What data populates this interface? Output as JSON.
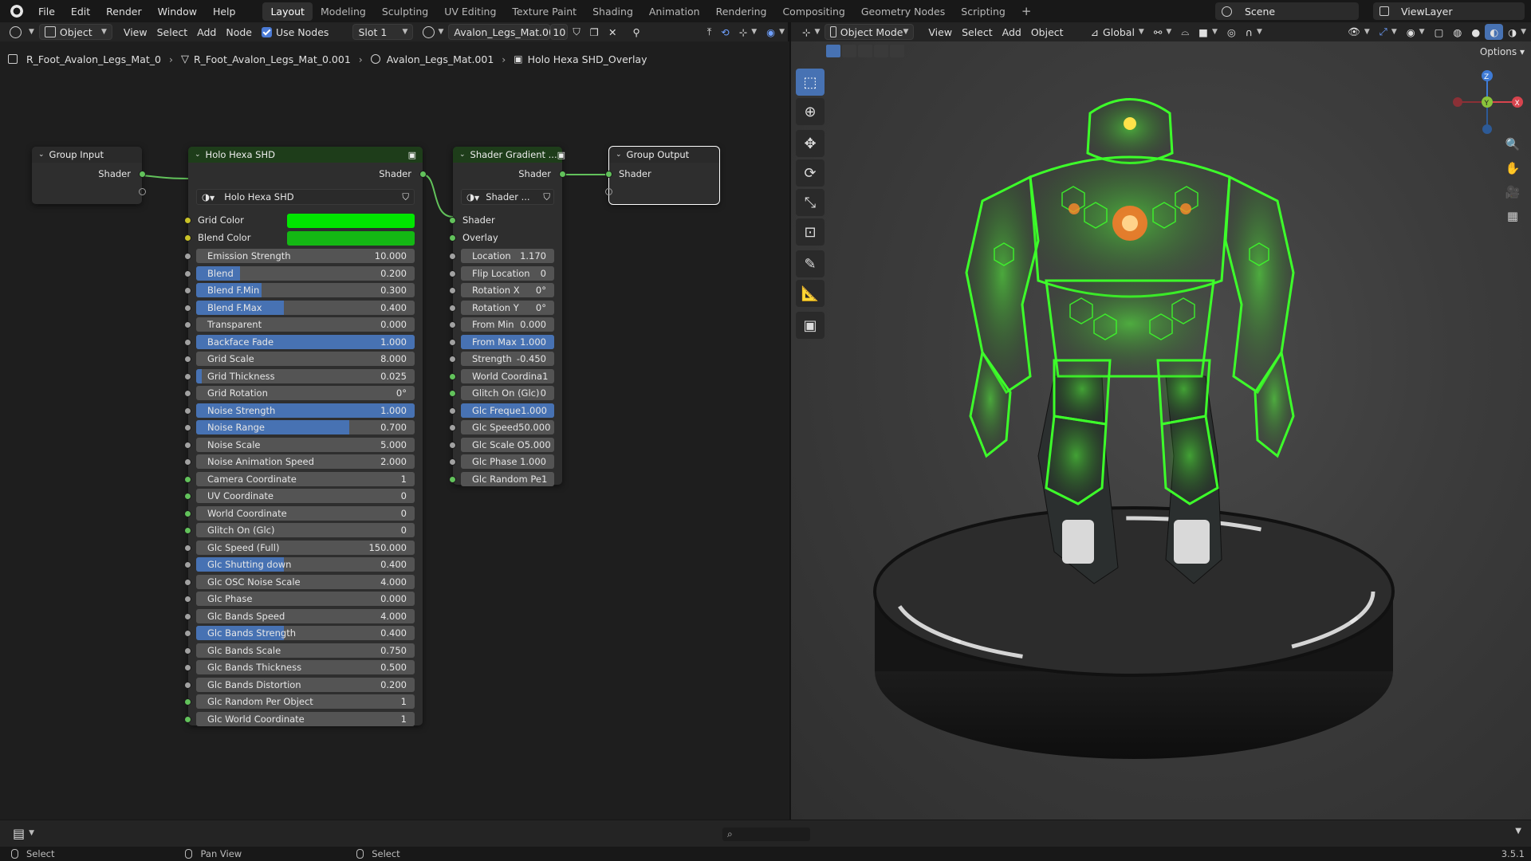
{
  "topbar": {
    "menus": [
      "File",
      "Edit",
      "Render",
      "Window",
      "Help"
    ],
    "workspaces": [
      "Layout",
      "Modeling",
      "Sculpting",
      "UV Editing",
      "Texture Paint",
      "Shading",
      "Animation",
      "Rendering",
      "Compositing",
      "Geometry Nodes",
      "Scripting"
    ],
    "active_workspace": "Layout",
    "add_tab": "+",
    "scene": "Scene",
    "view_layer": "ViewLayer"
  },
  "node_header": {
    "object_mode": "Object",
    "menus": [
      "View",
      "Select",
      "Add",
      "Node"
    ],
    "use_nodes": "Use Nodes",
    "slot": "Slot 1",
    "material": "Avalon_Legs_Mat.001",
    "users": "10"
  },
  "breadcrumb": [
    "R_Foot_Avalon_Legs_Mat_0",
    "R_Foot_Avalon_Legs_Mat_0.001",
    "Avalon_Legs_Mat.001",
    "Holo Hexa SHD_Overlay"
  ],
  "group_input": {
    "title": "Group Input",
    "output": "Shader"
  },
  "holo_node": {
    "title": "Holo Hexa SHD",
    "output": "Shader",
    "tree": "Holo Hexa SHD",
    "grid_color_label": "Grid Color",
    "blend_color_label": "Blend Color",
    "grid_color": "#00e600",
    "blend_color": "#14b814",
    "fields": [
      {
        "label": "Emission Strength",
        "value": "10.000",
        "fill": 0
      },
      {
        "label": "Blend",
        "value": "0.200",
        "fill": 0.2
      },
      {
        "label": "Blend F.Min",
        "value": "0.300",
        "fill": 0.3
      },
      {
        "label": "Blend F.Max",
        "value": "0.400",
        "fill": 0.4
      },
      {
        "label": "Transparent",
        "value": "0.000",
        "fill": 0
      },
      {
        "label": "Backface Fade",
        "value": "1.000",
        "fill": 1
      },
      {
        "label": "Grid Scale",
        "value": "8.000",
        "fill": 0
      },
      {
        "label": "Grid Thickness",
        "value": "0.025",
        "fill": 0.025
      },
      {
        "label": "Grid Rotation",
        "value": "0°",
        "fill": 0
      },
      {
        "label": "Noise Strength",
        "value": "1.000",
        "fill": 1
      },
      {
        "label": "Noise Range",
        "value": "0.700",
        "fill": 0.7
      },
      {
        "label": "Noise Scale",
        "value": "5.000",
        "fill": 0
      },
      {
        "label": "Noise Animation Speed",
        "value": "2.000",
        "fill": 0
      },
      {
        "label": "Camera Coordinate",
        "value": "1",
        "fill": 0
      },
      {
        "label": "UV Coordinate",
        "value": "0",
        "fill": 0
      },
      {
        "label": "World Coordinate",
        "value": "0",
        "fill": 0
      },
      {
        "label": "Glitch On (Glc)",
        "value": "0",
        "fill": 0
      },
      {
        "label": "Glc Speed (Full)",
        "value": "150.000",
        "fill": 0
      },
      {
        "label": "Glc Shutting down",
        "value": "0.400",
        "fill": 0.4
      },
      {
        "label": "Glc OSC Noise Scale",
        "value": "4.000",
        "fill": 0
      },
      {
        "label": "Glc Phase",
        "value": "0.000",
        "fill": 0
      },
      {
        "label": "Glc Bands Speed",
        "value": "4.000",
        "fill": 0
      },
      {
        "label": "Glc Bands Strength",
        "value": "0.400",
        "fill": 0.4
      },
      {
        "label": "Glc Bands Scale",
        "value": "0.750",
        "fill": 0
      },
      {
        "label": "Glc Bands Thickness",
        "value": "0.500",
        "fill": 0
      },
      {
        "label": "Glc Bands Distortion",
        "value": "0.200",
        "fill": 0
      },
      {
        "label": "Glc Random Per Object",
        "value": "1",
        "fill": 0
      },
      {
        "label": "Glc World Coordinate",
        "value": "1",
        "fill": 0
      }
    ]
  },
  "gradient_node": {
    "title": "Shader Gradient ...",
    "output": "Shader",
    "tree": "Shader ...",
    "inputs": [
      "Shader",
      "Overlay"
    ],
    "fields": [
      {
        "label": "Location",
        "value": "1.170",
        "fill": 0
      },
      {
        "label": "Flip Location",
        "value": "0",
        "fill": 0
      },
      {
        "label": "Rotation X",
        "value": "0°",
        "fill": 0
      },
      {
        "label": "Rotation Y",
        "value": "0°",
        "fill": 0
      },
      {
        "label": "From Min",
        "value": "0.000",
        "fill": 0
      },
      {
        "label": "From Max",
        "value": "1.000",
        "fill": 1
      },
      {
        "label": "Strength",
        "value": "-0.450",
        "fill": 0
      },
      {
        "label": "World Coordina",
        "value": "1",
        "fill": 0
      },
      {
        "label": "Glitch On (Glc)",
        "value": "0",
        "fill": 0
      },
      {
        "label": "Glc Freque",
        "value": "1.000",
        "fill": 1
      },
      {
        "label": "Glc Speed",
        "value": "50.000",
        "fill": 0
      },
      {
        "label": "Glc Scale O",
        "value": "5.000",
        "fill": 0
      },
      {
        "label": "Glc Phase",
        "value": "1.000",
        "fill": 0
      },
      {
        "label": "Glc Random Pe",
        "value": "1",
        "fill": 0
      }
    ]
  },
  "group_output": {
    "title": "Group Output",
    "input": "Shader"
  },
  "viewport_header": {
    "mode": "Object Mode",
    "menus": [
      "View",
      "Select",
      "Add",
      "Object"
    ],
    "orientation": "Global",
    "options": "Options"
  },
  "status_bar": {
    "items": [
      "Select",
      "Pan View",
      "Select"
    ],
    "version": "3.5.1"
  },
  "colors": {
    "accent": "#4772b3",
    "socket_green": "#62c25b",
    "socket_yellow": "#c9c227",
    "holo_green": "#3dff2a"
  }
}
